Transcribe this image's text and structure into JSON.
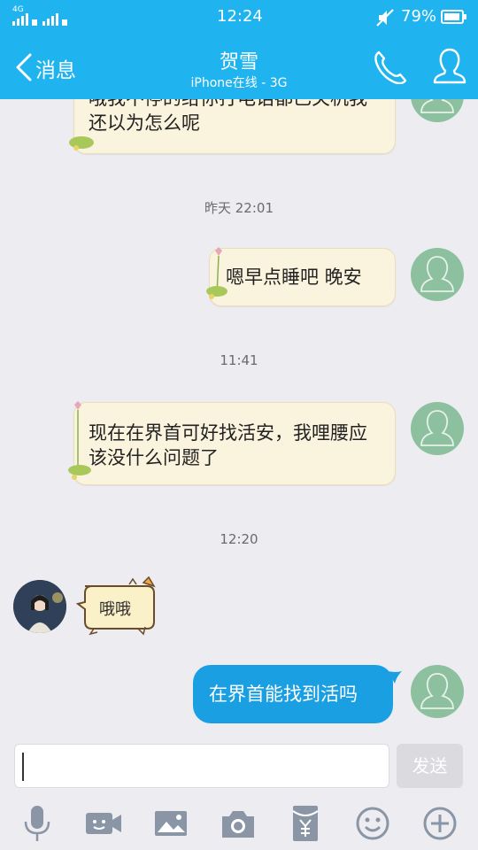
{
  "status": {
    "network": "4G",
    "time": "12:24",
    "battery": "79%"
  },
  "header": {
    "back_label": "消息",
    "title": "贺雪",
    "subtitle": "iPhone在线 - 3G"
  },
  "messages": [
    {
      "side": "right-cream",
      "text": "哦我不停的给你打电话都已关机我还以为怎么呢"
    },
    {
      "type": "time",
      "text": "昨天 22:01"
    },
    {
      "side": "right-cream",
      "text": "嗯早点睡吧 晚安"
    },
    {
      "type": "time",
      "text": "11:41"
    },
    {
      "side": "right-cream",
      "text": "现在在界首可好找活安，我哩腰应该没什么问题了"
    },
    {
      "type": "time",
      "text": "12:20"
    },
    {
      "side": "left-sticker",
      "text": "哦哦"
    },
    {
      "side": "right-blue",
      "text": "在界首能找到活吗"
    }
  ],
  "input": {
    "placeholder": "",
    "send_label": "发送"
  },
  "toolbar": [
    "microphone-icon",
    "video-icon",
    "image-icon",
    "camera-icon",
    "red-envelope-icon",
    "emoji-icon",
    "plus-icon"
  ],
  "colors": {
    "header_blue": "#1fb4f0",
    "bubble_blue": "#1a9fe3",
    "bubble_cream": "#faf3dd",
    "background": "#ececf1"
  }
}
